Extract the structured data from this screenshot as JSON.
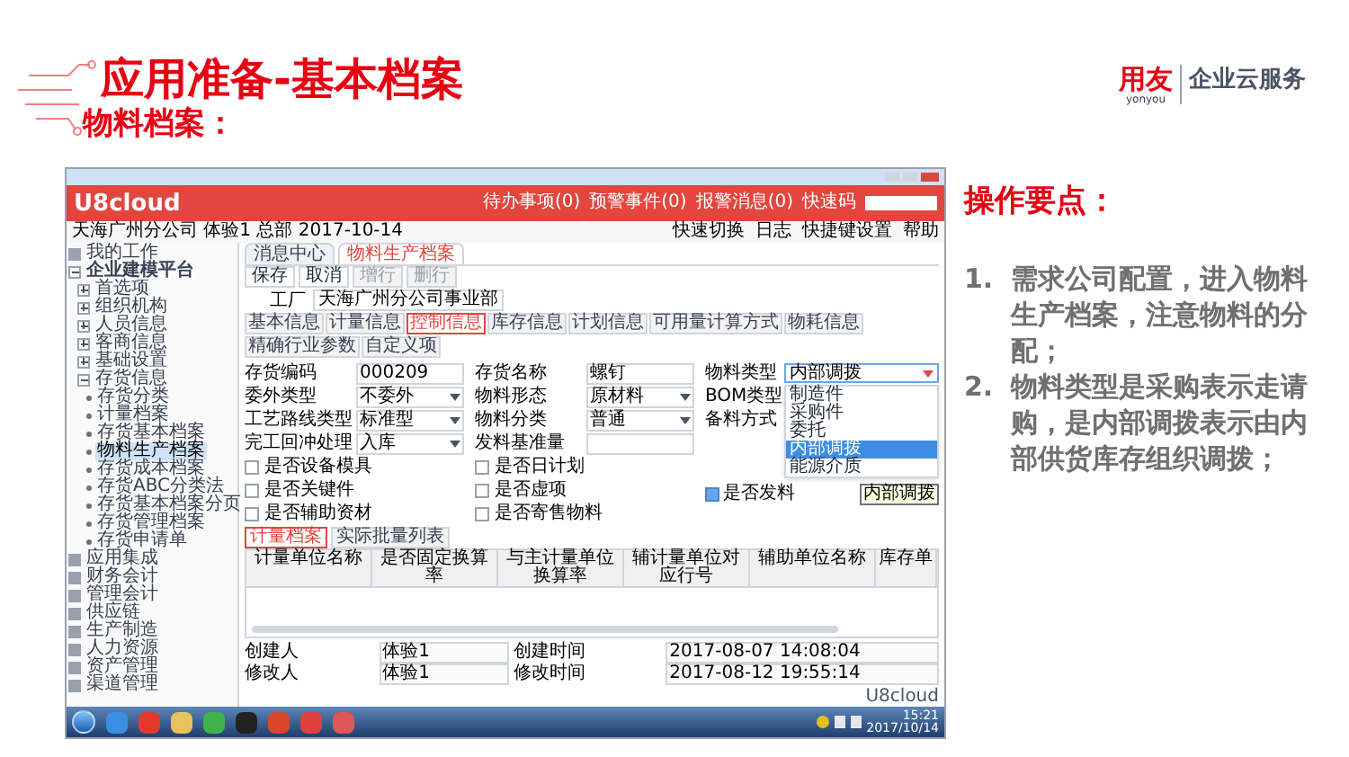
{
  "slide": {
    "title": "应用准备-基本档案",
    "subtitle": "物料档案：",
    "logo": {
      "brand": "用友",
      "brand_sub": "yonyou",
      "service": "企业云服务"
    }
  },
  "app": {
    "logo": "U8cloud",
    "header_links": [
      "待办事项(0)",
      "预警事件(0)",
      "报警消息(0)"
    ],
    "quick_code_label": "快速码",
    "context": "天海广州分公司 体验1 总部 2017-10-14",
    "context_actions": [
      "快速切换",
      "日志",
      "快捷键设置",
      "帮助"
    ],
    "sidebar": [
      {
        "label": "我的工作",
        "selected": false
      },
      {
        "label": "企业建模平台",
        "selected": false,
        "expanded": true,
        "children": [
          {
            "label": "首选项",
            "selected": false,
            "expanded": false
          },
          {
            "label": "组织机构",
            "selected": false,
            "expanded": false
          },
          {
            "label": "人员信息",
            "selected": false,
            "expanded": false
          },
          {
            "label": "客商信息",
            "selected": false,
            "expanded": false
          },
          {
            "label": "基础设置",
            "selected": false,
            "expanded": false
          },
          {
            "label": "存货信息",
            "selected": false,
            "expanded": true,
            "children": [
              {
                "label": "存货分类",
                "selected": false
              },
              {
                "label": "计量档案",
                "selected": false
              },
              {
                "label": "存货基本档案",
                "selected": false
              },
              {
                "label": "物料生产档案",
                "selected": true
              },
              {
                "label": "存货成本档案",
                "selected": false
              },
              {
                "label": "存货ABC分类法",
                "selected": false
              },
              {
                "label": "存货基本档案分页",
                "selected": false
              },
              {
                "label": "存货管理档案",
                "selected": false
              },
              {
                "label": "存货申请单",
                "selected": false
              }
            ]
          }
        ]
      },
      {
        "label": "应用集成",
        "selected": false
      },
      {
        "label": "财务会计",
        "selected": false
      },
      {
        "label": "管理会计",
        "selected": false
      },
      {
        "label": "供应链",
        "selected": false
      },
      {
        "label": "生产制造",
        "selected": false
      },
      {
        "label": "人力资源",
        "selected": false
      },
      {
        "label": "资产管理",
        "selected": false
      },
      {
        "label": "渠道管理",
        "selected": false
      }
    ],
    "tabs": [
      {
        "label": "消息中心",
        "selected": false
      },
      {
        "label": "物料生产档案",
        "selected": true
      }
    ],
    "toolbar": [
      {
        "label": "保存",
        "disabled": false
      },
      {
        "label": "取消",
        "disabled": false
      },
      {
        "label": "增行",
        "disabled": true
      },
      {
        "label": "删行",
        "disabled": true
      }
    ],
    "plant": {
      "label": "工厂",
      "value": "天海广州分公司事业部"
    },
    "subtabs": [
      {
        "label": "基本信息",
        "selected": false
      },
      {
        "label": "计量信息",
        "selected": false
      },
      {
        "label": "控制信息",
        "selected": true
      },
      {
        "label": "库存信息",
        "selected": false
      },
      {
        "label": "计划信息",
        "selected": false
      },
      {
        "label": "可用量计算方式",
        "selected": false
      },
      {
        "label": "物耗信息",
        "selected": false
      },
      {
        "label": "精确行业参数",
        "selected": false
      },
      {
        "label": "自定义项",
        "selected": false
      }
    ],
    "form_columns": [
      [
        {
          "kind": "text",
          "label": "存货编码",
          "value": "000209"
        },
        {
          "kind": "select",
          "label": "委外类型",
          "value": "不委外"
        },
        {
          "kind": "select",
          "label": "工艺路线类型",
          "value": "标准型"
        },
        {
          "kind": "select",
          "label": "完工回冲处理",
          "value": "入库"
        },
        {
          "kind": "checkbox",
          "label": "是否设备模具",
          "checked": false
        },
        {
          "kind": "checkbox",
          "label": "是否关键件",
          "checked": false
        },
        {
          "kind": "checkbox",
          "label": "是否辅助资材",
          "checked": false
        }
      ],
      [
        {
          "kind": "text",
          "label": "存货名称",
          "value": "螺钉"
        },
        {
          "kind": "select",
          "label": "物料形态",
          "value": "原材料"
        },
        {
          "kind": "select",
          "label": "物料分类",
          "value": "普通"
        },
        {
          "kind": "text",
          "label": "发料基准量"
        },
        {
          "kind": "checkbox",
          "label": "是否日计划",
          "checked": false
        },
        {
          "kind": "checkbox",
          "label": "是否虚项",
          "checked": false
        },
        {
          "kind": "checkbox",
          "label": "是否寄售物料",
          "checked": false
        }
      ]
    ],
    "material_type": {
      "label": "物料类型",
      "value": "内部调拨",
      "other_labels": [
        "BOM类型",
        "备料方式"
      ],
      "options": [
        {
          "label": "制造件",
          "selected": false
        },
        {
          "label": "采购件",
          "selected": false
        },
        {
          "label": "委托",
          "selected": false
        },
        {
          "label": "内部调拨",
          "selected": true
        },
        {
          "label": "能源介质",
          "selected": false
        }
      ],
      "tooltip": "内部调拨",
      "issue": {
        "label": "是否发料",
        "checked": true
      }
    },
    "detail_tabs": [
      {
        "label": "计量档案",
        "selected": true
      },
      {
        "label": "实际批量列表",
        "selected": false
      }
    ],
    "table_columns": [
      "计量单位名称",
      "是否固定换算率",
      "与主计量单位换算率",
      "辅计量单位对应行号",
      "辅助单位名称",
      "库存单"
    ],
    "footer": [
      {
        "label": "创建人",
        "value": "体验1"
      },
      {
        "label": "创建时间",
        "value": "2017-08-07 14:08:04"
      },
      {
        "label": "修改人",
        "value": "体验1"
      },
      {
        "label": "修改时间",
        "value": "2017-08-12 19:55:14"
      }
    ],
    "status": "U8cloud"
  },
  "taskbar": {
    "time": "15:21",
    "date": "2017/10/14"
  },
  "notes": {
    "title": "操作要点：",
    "items": [
      {
        "number": "1.",
        "text": "需求公司配置，进入物料生产档案，注意物料的分配；"
      },
      {
        "number": "2.",
        "text": "物料类型是采购表示走请购，是内部调拨表示由内部供货库存组织调拨；"
      }
    ]
  }
}
